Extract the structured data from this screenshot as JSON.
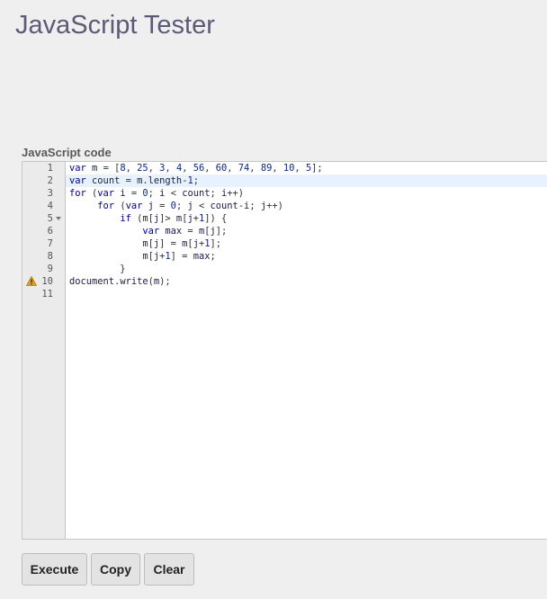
{
  "page_title": "JavaScript Tester",
  "section_label": "JavaScript code",
  "editor": {
    "active_line": 2,
    "warning_line": 10,
    "fold_line": 5,
    "line_numbers": [
      "1",
      "2",
      "3",
      "4",
      "5",
      "6",
      "7",
      "8",
      "9",
      "10",
      "11"
    ],
    "lines": [
      "var m = [8, 25, 3, 4, 56, 60, 74, 89, 10, 5];",
      "var count = m.length-1;",
      "for (var i = 0; i < count; i++)",
      "     for (var j = 0; j < count-i; j++)",
      "         if (m[j]> m[j+1]) {",
      "             var max = m[j];",
      "             m[j] = m[j+1];",
      "             m[j+1] = max;",
      "         }",
      "document.write(m);",
      ""
    ]
  },
  "buttons": {
    "execute": "Execute",
    "copy": "Copy",
    "clear": "Clear"
  },
  "colors": {
    "title": "#5d5a76",
    "keyword": "#0000a5",
    "active_line": "#e8f2ff",
    "warning": "#e0a11b"
  }
}
